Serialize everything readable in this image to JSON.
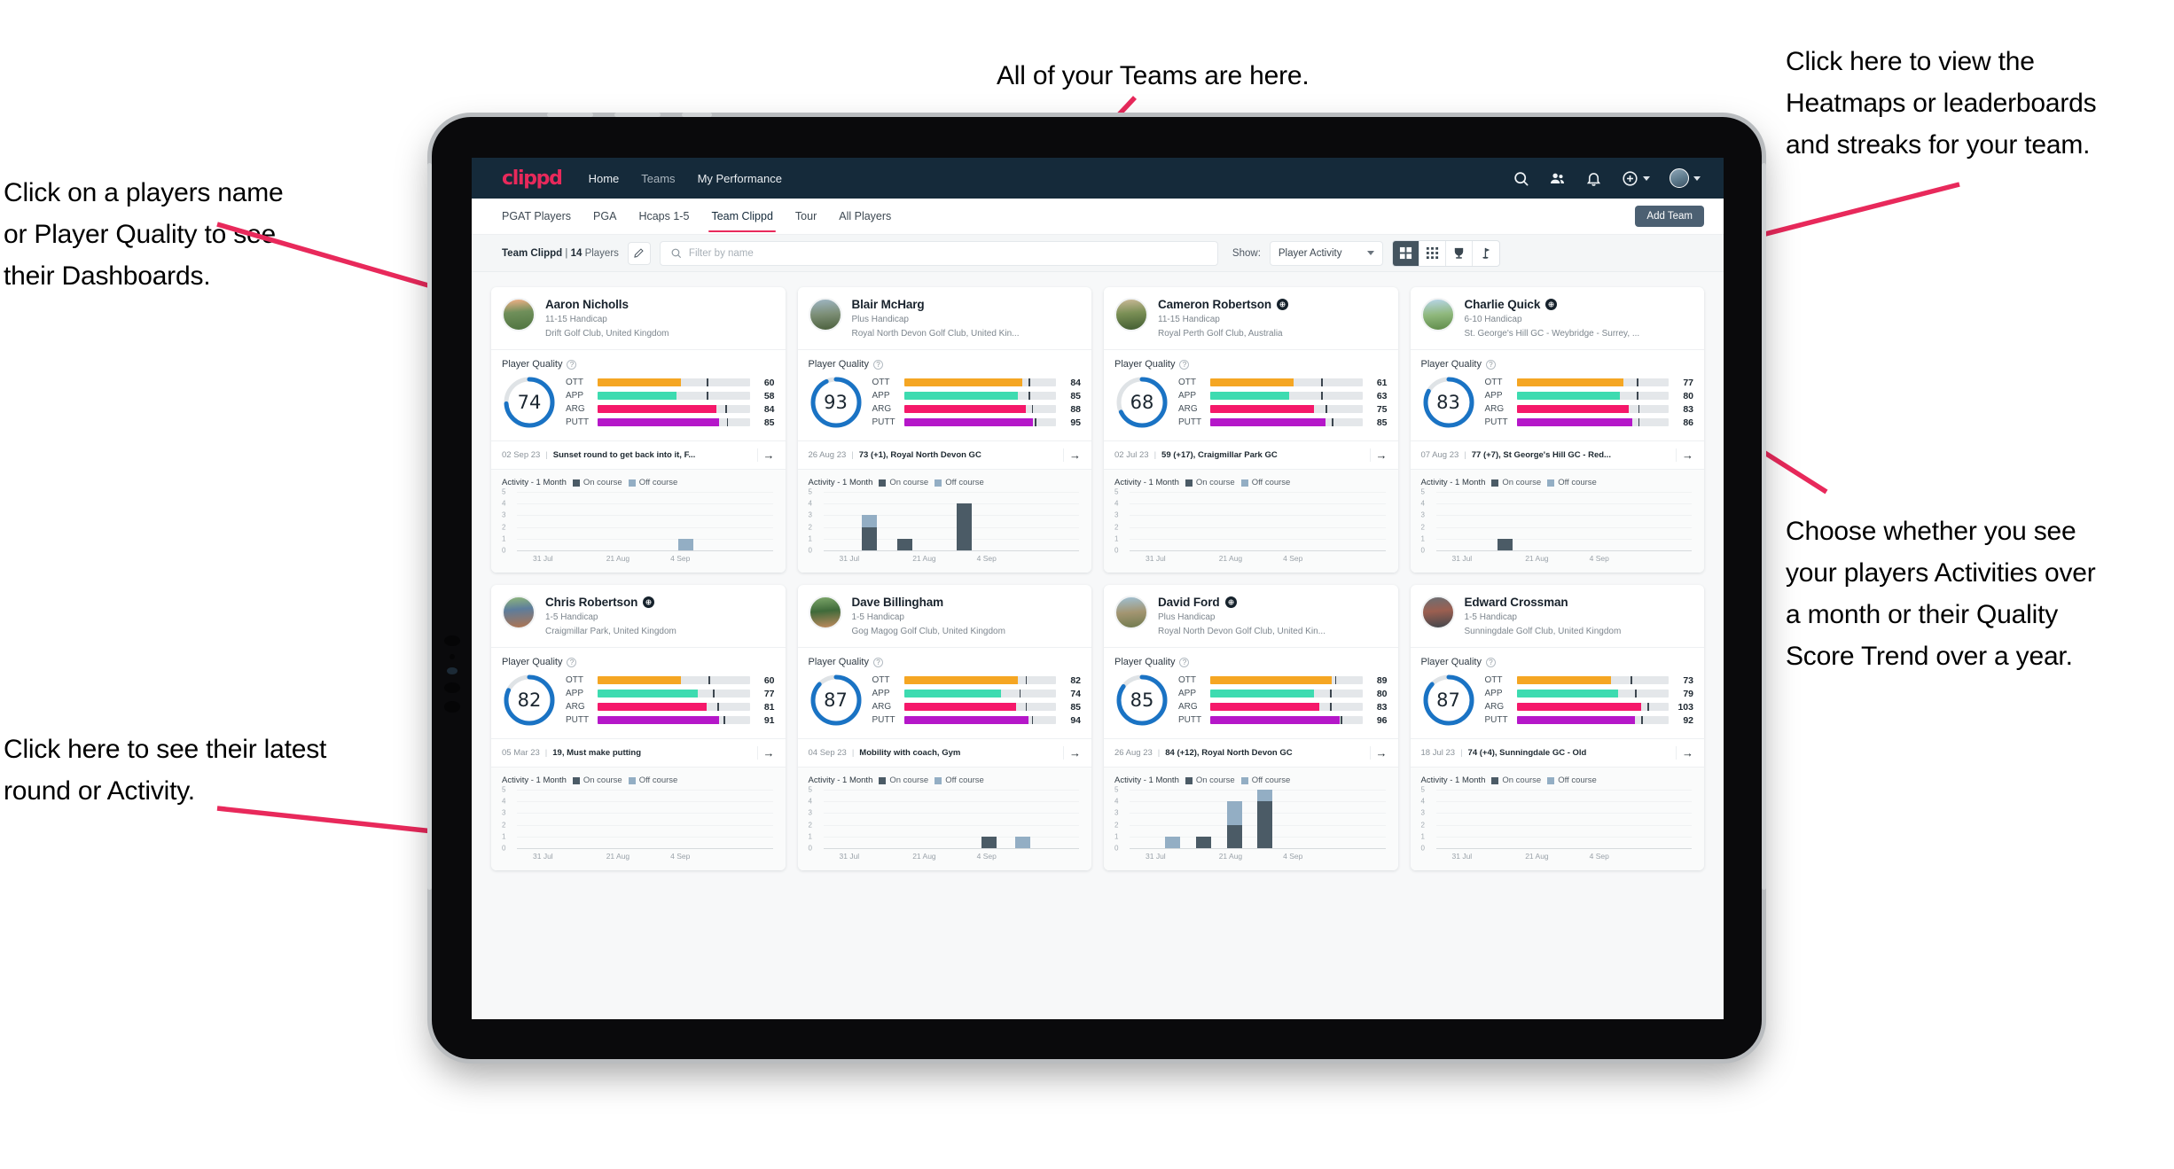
{
  "annotations": {
    "top": "All of your Teams are here.",
    "left_top": "Click on a players name\nor Player Quality to see\ntheir Dashboards.",
    "left_bottom": "Click here to see their latest\nround or Activity.",
    "right_top": "Click here to view the\nHeatmaps or leaderboards\nand streaks for your team.",
    "right_bottom": "Choose whether you see\nyour players Activities over\na month or their Quality\nScore Trend over a year.",
    "arrow_color": "#e8295b"
  },
  "navbar": {
    "logo": "clippd",
    "links": [
      {
        "label": "Home",
        "active": true
      },
      {
        "label": "Teams",
        "active": false
      },
      {
        "label": "My Performance",
        "active": true
      }
    ],
    "icons": [
      "search-icon",
      "people-icon",
      "bell-icon",
      "plus-circle-icon",
      "avatar"
    ]
  },
  "tabs": [
    {
      "label": "PGAT Players",
      "active": false
    },
    {
      "label": "PGA",
      "active": false
    },
    {
      "label": "Hcaps 1-5",
      "active": false
    },
    {
      "label": "Team Clippd",
      "active": true
    },
    {
      "label": "Tour",
      "active": false
    },
    {
      "label": "All Players",
      "active": false
    }
  ],
  "add_team_label": "Add Team",
  "filterbar": {
    "team_name": "Team Clippd",
    "separator": "|",
    "player_count": "14",
    "players_word": "Players",
    "search_placeholder": "Filter by name",
    "search_value": "",
    "show_label": "Show:",
    "show_value": "Player Activity",
    "show_options": [
      "Player Activity",
      "Quality Score Trend"
    ],
    "view_modes": [
      "grid-large-icon",
      "grid-small-icon",
      "trophy-icon",
      "flag-icon"
    ],
    "active_view": 0
  },
  "card_labels": {
    "player_quality": "Player Quality",
    "activity": "Activity - 1 Month",
    "on_course": "On course",
    "off_course": "Off course",
    "metric_labels": [
      "OTT",
      "APP",
      "ARG",
      "PUTT"
    ],
    "x_ticks": [
      "31 Jul",
      "21 Aug",
      "4 Sep"
    ],
    "y_ticks": [
      "5",
      "4",
      "3",
      "2",
      "1",
      "0"
    ]
  },
  "colors": {
    "ott": "#f5a623",
    "app": "#3ddbb0",
    "arg": "#f5186a",
    "putt": "#b517c9",
    "ring": "#1a73c4",
    "ring_track": "#dfe3e6",
    "on_course": "#4b5b66",
    "off_course": "#93aec4",
    "accent": "#e8295b",
    "navbar": "#152a3a"
  },
  "players": [
    {
      "name": "Aaron Nicholls",
      "verified": false,
      "handicap": "11-15 Handicap",
      "club": "Drift Golf Club, United Kingdom",
      "quality": 74,
      "metrics": [
        {
          "label": "OTT",
          "value": 60,
          "fill": 55,
          "tick": 72
        },
        {
          "label": "APP",
          "value": 58,
          "fill": 52,
          "tick": 72
        },
        {
          "label": "ARG",
          "value": 84,
          "fill": 78,
          "tick": 84
        },
        {
          "label": "PUTT",
          "value": 85,
          "fill": 80,
          "tick": 85
        }
      ],
      "latest": {
        "date": "02 Sep 23",
        "text": "Sunset round to get back into it, F..."
      },
      "chart_data": {
        "type": "bar",
        "title": "Activity - 1 Month",
        "categories": [
          "31 Jul",
          "21 Aug",
          "4 Sep"
        ],
        "ylim": [
          0,
          5
        ],
        "series": [
          {
            "name": "On course",
            "color": "#4b5b66"
          },
          {
            "name": "Off course",
            "color": "#93aec4"
          }
        ],
        "bars": [
          {
            "pos": 63,
            "on": 0,
            "off": 1
          }
        ]
      }
    },
    {
      "name": "Blair McHarg",
      "verified": false,
      "handicap": "Plus Handicap",
      "club": "Royal North Devon Golf Club, United Kin...",
      "quality": 93,
      "metrics": [
        {
          "label": "OTT",
          "value": 84,
          "fill": 78,
          "tick": 82
        },
        {
          "label": "APP",
          "value": 85,
          "fill": 75,
          "tick": 82
        },
        {
          "label": "ARG",
          "value": 88,
          "fill": 80,
          "tick": 84
        },
        {
          "label": "PUTT",
          "value": 95,
          "fill": 85,
          "tick": 86
        }
      ],
      "latest": {
        "date": "26 Aug 23",
        "text": "73 (+1), Royal North Devon GC"
      },
      "chart_data": {
        "type": "bar",
        "title": "Activity - 1 Month",
        "categories": [
          "31 Jul",
          "21 Aug",
          "4 Sep"
        ],
        "ylim": [
          0,
          5
        ],
        "series": [
          {
            "name": "On course",
            "color": "#4b5b66"
          },
          {
            "name": "Off course",
            "color": "#93aec4"
          }
        ],
        "bars": [
          {
            "pos": 15,
            "on": 2,
            "off": 1
          },
          {
            "pos": 29,
            "on": 1,
            "off": 0
          },
          {
            "pos": 52,
            "on": 4,
            "off": 0
          }
        ]
      }
    },
    {
      "name": "Cameron Robertson",
      "verified": true,
      "handicap": "11-15 Handicap",
      "club": "Royal Perth Golf Club, Australia",
      "quality": 68,
      "metrics": [
        {
          "label": "OTT",
          "value": 61,
          "fill": 55,
          "tick": 73
        },
        {
          "label": "APP",
          "value": 63,
          "fill": 52,
          "tick": 73
        },
        {
          "label": "ARG",
          "value": 75,
          "fill": 68,
          "tick": 76
        },
        {
          "label": "PUTT",
          "value": 85,
          "fill": 76,
          "tick": 80
        }
      ],
      "latest": {
        "date": "02 Jul 23",
        "text": "59 (+17), Craigmillar Park GC"
      },
      "chart_data": {
        "type": "bar",
        "title": "Activity - 1 Month",
        "categories": [
          "31 Jul",
          "21 Aug",
          "4 Sep"
        ],
        "ylim": [
          0,
          5
        ],
        "series": [
          {
            "name": "On course",
            "color": "#4b5b66"
          },
          {
            "name": "Off course",
            "color": "#93aec4"
          }
        ],
        "bars": []
      }
    },
    {
      "name": "Charlie Quick",
      "verified": true,
      "handicap": "6-10 Handicap",
      "club": "St. George's Hill GC - Weybridge - Surrey, ...",
      "quality": 83,
      "metrics": [
        {
          "label": "OTT",
          "value": 77,
          "fill": 70,
          "tick": 79
        },
        {
          "label": "APP",
          "value": 80,
          "fill": 68,
          "tick": 79
        },
        {
          "label": "ARG",
          "value": 83,
          "fill": 74,
          "tick": 80
        },
        {
          "label": "PUTT",
          "value": 86,
          "fill": 76,
          "tick": 80
        }
      ],
      "latest": {
        "date": "07 Aug 23",
        "text": "77 (+7), St George's Hill GC - Red..."
      },
      "chart_data": {
        "type": "bar",
        "title": "Activity - 1 Month",
        "categories": [
          "31 Jul",
          "21 Aug",
          "4 Sep"
        ],
        "ylim": [
          0,
          5
        ],
        "series": [
          {
            "name": "On course",
            "color": "#4b5b66"
          },
          {
            "name": "Off course",
            "color": "#93aec4"
          }
        ],
        "bars": [
          {
            "pos": 24,
            "on": 1,
            "off": 0
          }
        ]
      }
    },
    {
      "name": "Chris Robertson",
      "verified": true,
      "handicap": "1-5 Handicap",
      "club": "Craigmillar Park, United Kingdom",
      "quality": 82,
      "metrics": [
        {
          "label": "OTT",
          "value": 60,
          "fill": 55,
          "tick": 73
        },
        {
          "label": "APP",
          "value": 77,
          "fill": 66,
          "tick": 76
        },
        {
          "label": "ARG",
          "value": 81,
          "fill": 72,
          "tick": 79
        },
        {
          "label": "PUTT",
          "value": 91,
          "fill": 80,
          "tick": 83
        }
      ],
      "latest": {
        "date": "05 Mar 23",
        "text": "19, Must make putting"
      },
      "chart_data": {
        "type": "bar",
        "title": "Activity - 1 Month",
        "categories": [
          "31 Jul",
          "21 Aug",
          "4 Sep"
        ],
        "ylim": [
          0,
          5
        ],
        "series": [
          {
            "name": "On course",
            "color": "#4b5b66"
          },
          {
            "name": "Off course",
            "color": "#93aec4"
          }
        ],
        "bars": []
      }
    },
    {
      "name": "Dave Billingham",
      "verified": false,
      "handicap": "1-5 Handicap",
      "club": "Gog Magog Golf Club, United Kingdom",
      "quality": 87,
      "metrics": [
        {
          "label": "OTT",
          "value": 82,
          "fill": 75,
          "tick": 80
        },
        {
          "label": "APP",
          "value": 74,
          "fill": 64,
          "tick": 76
        },
        {
          "label": "ARG",
          "value": 85,
          "fill": 74,
          "tick": 80
        },
        {
          "label": "PUTT",
          "value": 94,
          "fill": 82,
          "tick": 84
        }
      ],
      "latest": {
        "date": "04 Sep 23",
        "text": "Mobility with coach, Gym"
      },
      "chart_data": {
        "type": "bar",
        "title": "Activity - 1 Month",
        "categories": [
          "31 Jul",
          "21 Aug",
          "4 Sep"
        ],
        "ylim": [
          0,
          5
        ],
        "series": [
          {
            "name": "On course",
            "color": "#4b5b66"
          },
          {
            "name": "Off course",
            "color": "#93aec4"
          }
        ],
        "bars": [
          {
            "pos": 62,
            "on": 1,
            "off": 0
          },
          {
            "pos": 75,
            "on": 0,
            "off": 1
          }
        ]
      }
    },
    {
      "name": "David Ford",
      "verified": true,
      "handicap": "Plus Handicap",
      "club": "Royal North Devon Golf Club, United Kin...",
      "quality": 85,
      "metrics": [
        {
          "label": "OTT",
          "value": 89,
          "fill": 80,
          "tick": 82
        },
        {
          "label": "APP",
          "value": 80,
          "fill": 68,
          "tick": 79
        },
        {
          "label": "ARG",
          "value": 83,
          "fill": 72,
          "tick": 79
        },
        {
          "label": "PUTT",
          "value": 96,
          "fill": 85,
          "tick": 86
        }
      ],
      "latest": {
        "date": "26 Aug 23",
        "text": "84 (+12), Royal North Devon GC"
      },
      "chart_data": {
        "type": "bar",
        "title": "Activity - 1 Month",
        "categories": [
          "31 Jul",
          "21 Aug",
          "4 Sep"
        ],
        "ylim": [
          0,
          5
        ],
        "series": [
          {
            "name": "On course",
            "color": "#4b5b66"
          },
          {
            "name": "Off course",
            "color": "#93aec4"
          }
        ],
        "bars": [
          {
            "pos": 14,
            "on": 0,
            "off": 1
          },
          {
            "pos": 26,
            "on": 1,
            "off": 0
          },
          {
            "pos": 38,
            "on": 2,
            "off": 2
          },
          {
            "pos": 50,
            "on": 4,
            "off": 1
          }
        ]
      }
    },
    {
      "name": "Edward Crossman",
      "verified": false,
      "handicap": "1-5 Handicap",
      "club": "Sunningdale Golf Club, United Kingdom",
      "quality": 87,
      "metrics": [
        {
          "label": "OTT",
          "value": 73,
          "fill": 62,
          "tick": 75
        },
        {
          "label": "APP",
          "value": 79,
          "fill": 67,
          "tick": 78
        },
        {
          "label": "ARG",
          "value": 103,
          "fill": 82,
          "tick": 86
        },
        {
          "label": "PUTT",
          "value": 92,
          "fill": 78,
          "tick": 82
        }
      ],
      "latest": {
        "date": "18 Jul 23",
        "text": "74 (+4), Sunningdale GC - Old"
      },
      "chart_data": {
        "type": "bar",
        "title": "Activity - 1 Month",
        "categories": [
          "31 Jul",
          "21 Aug",
          "4 Sep"
        ],
        "ylim": [
          0,
          5
        ],
        "series": [
          {
            "name": "On course",
            "color": "#4b5b66"
          },
          {
            "name": "Off course",
            "color": "#93aec4"
          }
        ],
        "bars": []
      }
    }
  ]
}
